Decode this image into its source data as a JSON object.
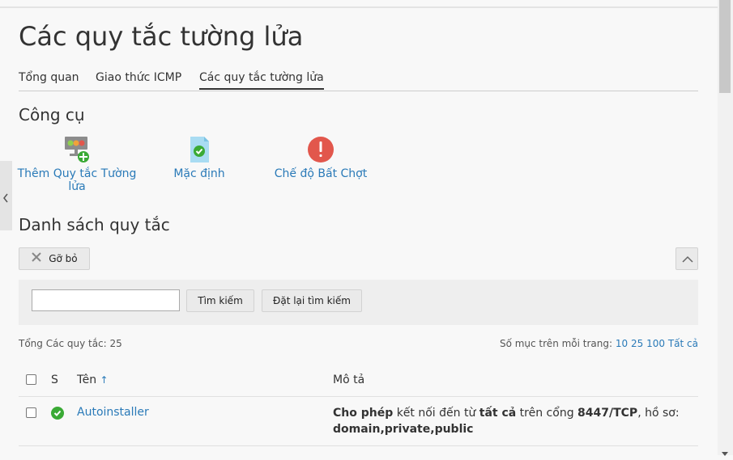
{
  "page": {
    "title": "Các quy tắc tường lửa"
  },
  "tabs": [
    {
      "label": "Tổng quan"
    },
    {
      "label": "Giao thức ICMP"
    },
    {
      "label": "Các quy tắc tường lửa",
      "active": true
    }
  ],
  "tools": {
    "heading": "Công cụ",
    "items": [
      {
        "label": "Thêm Quy tắc Tường lửa",
        "icon": "add-rule-icon"
      },
      {
        "label": "Mặc định",
        "icon": "default-document-check-icon"
      },
      {
        "label": "Chế độ Bất Chợt",
        "icon": "exclamation-icon"
      }
    ]
  },
  "rules_list": {
    "heading": "Danh sách quy tắc",
    "remove_label": "Gỡ bỏ",
    "search": {
      "value": "",
      "button": "Tìm kiếm",
      "reset": "Đặt lại tìm kiếm"
    },
    "total_label": "Tổng Các quy tắc: 25",
    "per_page_label": "Số mục trên mỗi trang:",
    "per_page_options": [
      "10",
      "25",
      "100",
      "Tất cả"
    ],
    "columns": {
      "status": "S",
      "name": "Tên",
      "sort_arrow": "↑",
      "description": "Mô tả"
    },
    "rows": [
      {
        "name": "Autoinstaller",
        "status": "enabled",
        "desc": {
          "allow": "Cho phép",
          "t1": " kết nối đến từ ",
          "all": "tất cả",
          "t2": " trên cổng ",
          "port": "8447/TCP",
          "t3": ", hồ sơ:",
          "profiles": "domain,private,public"
        }
      }
    ]
  },
  "colors": {
    "accent": "#2a7ab8",
    "success": "#3aaa35",
    "danger": "#e04f46"
  }
}
